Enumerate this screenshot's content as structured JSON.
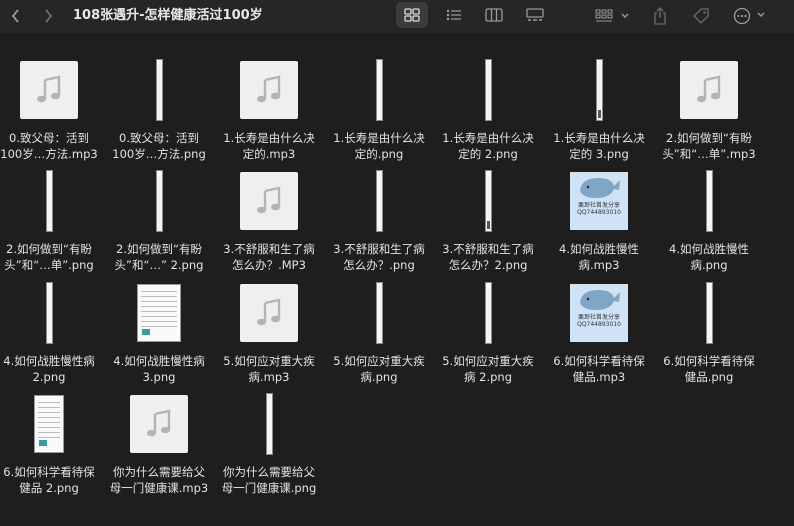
{
  "window": {
    "title": "108张遇升-怎样健康活过100岁"
  },
  "toolbar": {
    "icons": [
      "chevron-left-icon",
      "chevron-right-icon",
      "icon-view-icon",
      "list-view-icon",
      "column-view-icon",
      "gallery-view-icon",
      "group-icon",
      "share-icon",
      "tag-icon",
      "more-icon"
    ],
    "active_view": "icon-view"
  },
  "files": [
    {
      "label": "0.致父母：活到\n100岁…方法.mp3",
      "kind": "music"
    },
    {
      "label": "0.致父母：活到\n100岁…方法.png",
      "kind": "strip"
    },
    {
      "label": "1.长寿是由什么决\n定的.mp3",
      "kind": "music"
    },
    {
      "label": "1.长寿是由什么决\n定的.png",
      "kind": "strip"
    },
    {
      "label": "1.长寿是由什么决\n定的 2.png",
      "kind": "strip"
    },
    {
      "label": "1.长寿是由什么决\n定的 3.png",
      "kind": "strip-dark"
    },
    {
      "label": "2.如何做到“有盼\n头”和“…单”.mp3",
      "kind": "music"
    },
    {
      "label": "2.如何做到“有盼\n头”和“…单”.png",
      "kind": "strip"
    },
    {
      "label": "2.如何做到“有盼\n头”和“…” 2.png",
      "kind": "strip"
    },
    {
      "label": "3.不舒服和生了病\n怎么办？.MP3",
      "kind": "music"
    },
    {
      "label": "3.不舒服和生了病\n怎么办？.png",
      "kind": "strip"
    },
    {
      "label": "3.不舒服和生了病\n怎么办？2.png",
      "kind": "strip-dark"
    },
    {
      "label": "4.如何战胜慢性\n病.mp3",
      "kind": "whale"
    },
    {
      "label": "4.如何战胜慢性\n病.png",
      "kind": "strip"
    },
    {
      "label": "4.如何战胜慢性病\n2.png",
      "kind": "strip"
    },
    {
      "label": "4.如何战胜慢性病\n3.png",
      "kind": "doc-wide"
    },
    {
      "label": "5.如何应对重大疾\n病.mp3",
      "kind": "music"
    },
    {
      "label": "5.如何应对重大疾\n病.png",
      "kind": "strip"
    },
    {
      "label": "5.如何应对重大疾\n病 2.png",
      "kind": "strip"
    },
    {
      "label": "6.如何科学看待保\n健品.mp3",
      "kind": "whale"
    },
    {
      "label": "6.如何科学看待保\n健品.png",
      "kind": "strip"
    },
    {
      "label": "6.如何科学看待保\n健品 2.png",
      "kind": "doc"
    },
    {
      "label": "你为什么需要给父\n母一门健康课.mp3",
      "kind": "music"
    },
    {
      "label": "你为什么需要给父\n母一门健康课.png",
      "kind": "strip"
    }
  ],
  "whale_art": {
    "line1": "栗渺社首发分享",
    "line2": "QQ744893010"
  }
}
